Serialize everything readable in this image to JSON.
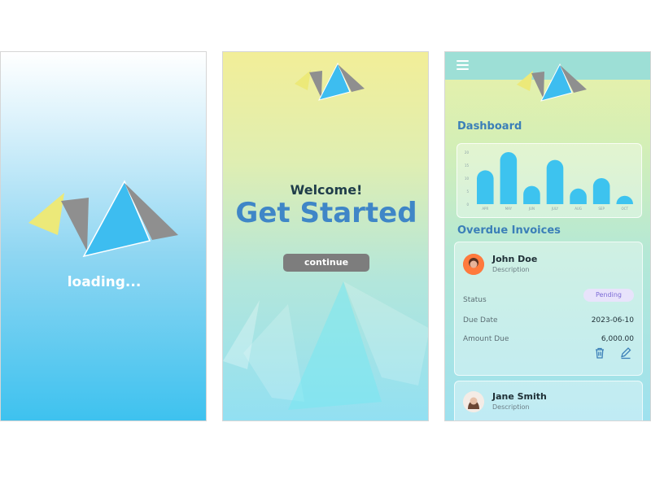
{
  "screens": {
    "loading": {
      "text": "loading..."
    },
    "welcome": {
      "greeting": "Welcome!",
      "headline": "Get Started",
      "button_label": "continue"
    },
    "dashboard": {
      "menu_icon": "hamburger-menu-icon",
      "title": "Dashboard",
      "overdue_title": "Overdue Invoices",
      "invoices": [
        {
          "name": "John Doe",
          "description": "Description",
          "status_label": "Status",
          "status": "Pending",
          "due_date_label": "Due Date",
          "due_date": "2023-06-10",
          "amount_label": "Amount Due",
          "amount": "6,000.00",
          "actions": [
            "trash-icon",
            "edit-icon"
          ]
        },
        {
          "name": "Jane Smith",
          "description": "Description"
        }
      ]
    }
  },
  "colors": {
    "accent_blue": "#3f86c7",
    "bar_blue": "#3dc3ef",
    "logo_yellow": "#ece979",
    "logo_gray": "#8f8f8f",
    "logo_cyan": "#3dbdf0",
    "button_gray": "#7d7d7d",
    "pending_text": "#7c6bd6"
  },
  "chart_data": {
    "type": "bar",
    "categories": [
      "APR",
      "MAY",
      "JUN",
      "JULY",
      "AUG",
      "SEP",
      "OCT"
    ],
    "values": [
      13,
      20,
      7,
      17,
      6,
      10,
      3
    ],
    "yticks": [
      0,
      5,
      10,
      15,
      20
    ],
    "ylim": [
      0,
      20
    ],
    "title": "",
    "xlabel": "",
    "ylabel": ""
  }
}
